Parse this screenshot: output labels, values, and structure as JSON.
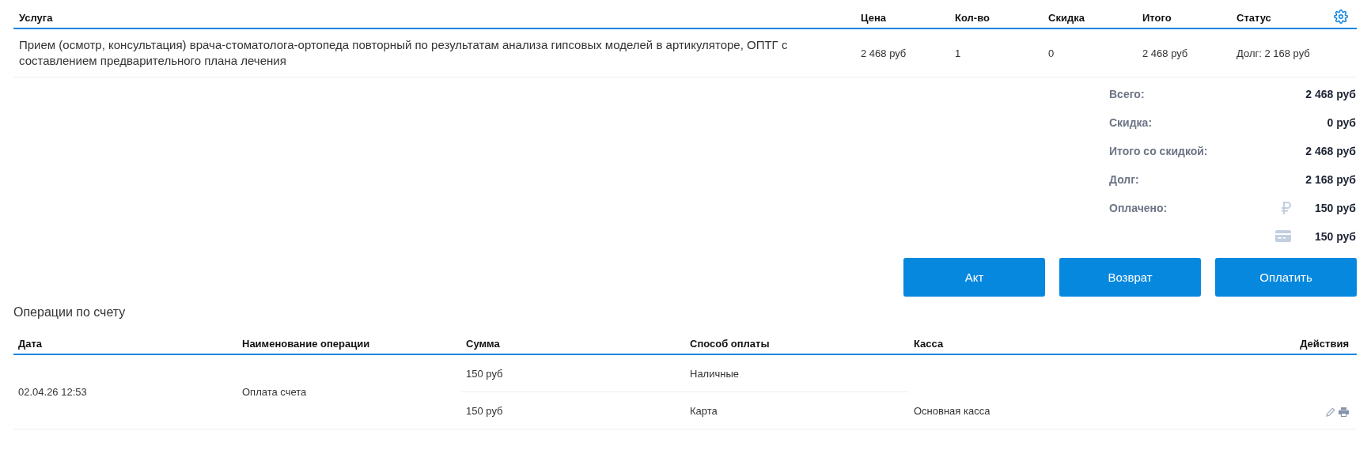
{
  "services": {
    "columns": [
      "Услуга",
      "Цена",
      "Кол-во",
      "Скидка",
      "Итого",
      "Статус"
    ],
    "rows": [
      {
        "cells": [
          "Прием (осмотр, консультация) врача-стоматолога-ортопеда повторный по результатам анализа гипсовых моделей в артикуляторе, ОПТГ с составлением предварительного плана лечения",
          "2 468 руб",
          "1",
          "0",
          "2 468 руб",
          "Долг: 2 168 руб"
        ]
      }
    ]
  },
  "summary": [
    {
      "label": "Всего:",
      "value": "2 468 руб"
    },
    {
      "label": "Скидка:",
      "value": "0 руб"
    },
    {
      "label": "Итого со скидкой:",
      "value": "2 468 руб"
    },
    {
      "label": "Долг:",
      "value": "2 168 руб"
    },
    {
      "label": "Оплачено:",
      "kind": "cash",
      "value": "150 руб"
    },
    {
      "kind": "card",
      "value": "150 руб"
    }
  ],
  "buttons": [
    "Акт",
    "Возврат",
    "Оплатить"
  ],
  "operations": {
    "title": "Операции по счету",
    "columns": [
      "Дата",
      "Наименование операции",
      "Сумма",
      "Способ оплаты",
      "Касса",
      "Действия"
    ],
    "rows": [
      {
        "date": "02.04.26 12:53",
        "name": "Оплата счета",
        "payments": [
          {
            "amount": "150 руб",
            "method": "Наличные"
          },
          {
            "amount": "150 руб",
            "method": "Карта"
          }
        ],
        "cashbox": "Основная касса"
      }
    ]
  }
}
